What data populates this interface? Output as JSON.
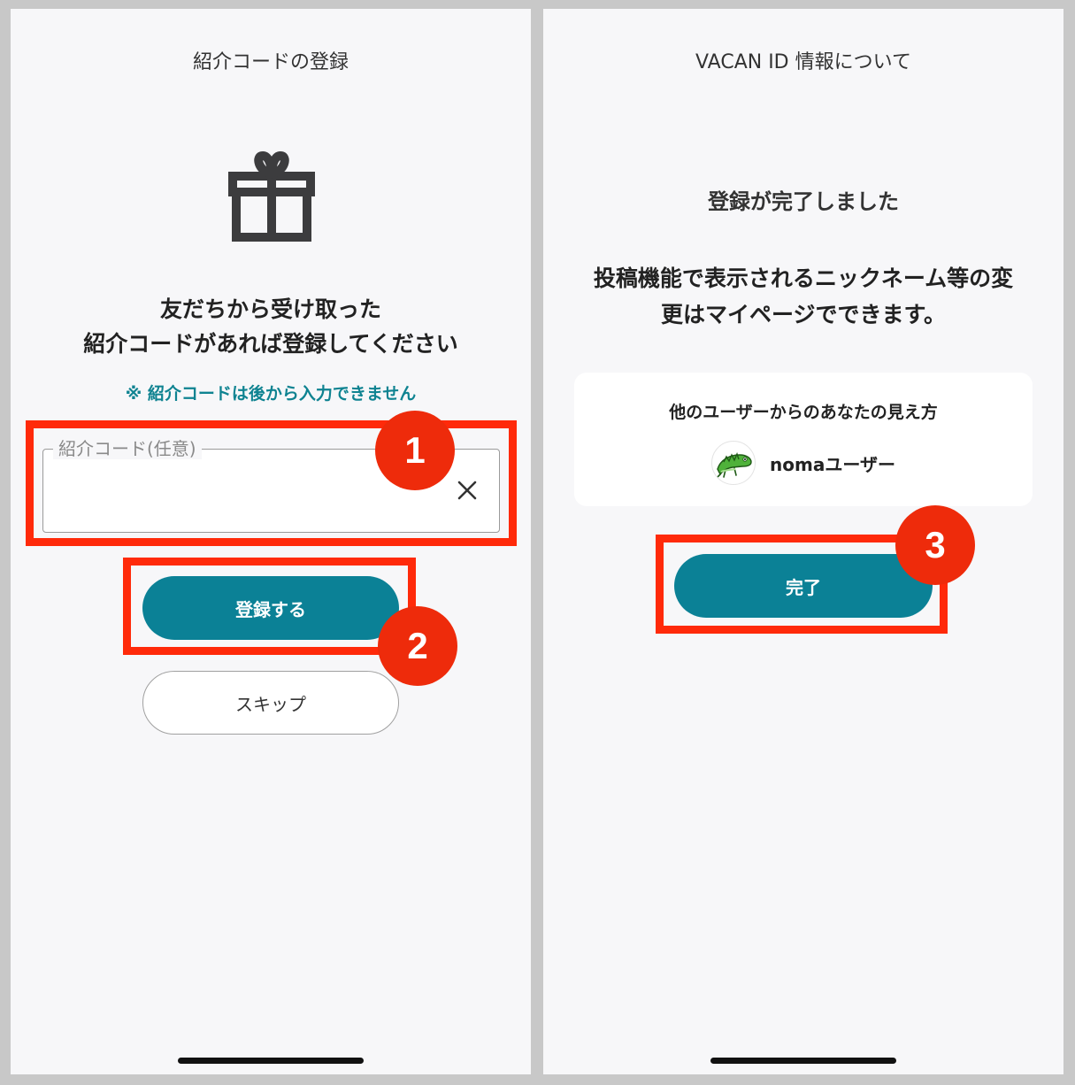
{
  "left_screen": {
    "title": "紹介コードの登録",
    "lead_line1": "友だちから受け取った",
    "lead_line2": "紹介コードがあれば登録してください",
    "note": "※ 紹介コードは後から入力できません",
    "code_field": {
      "label": "紹介コード(任意)",
      "value": ""
    },
    "register_button": "登録する",
    "skip_button": "スキップ"
  },
  "right_screen": {
    "title": "VACAN ID 情報について",
    "complete_title": "登録が完了しました",
    "body_line1": "投稿機能で表示されるニックネーム等の変",
    "body_line2": "更はマイページでできます。",
    "preview_caption": "他のユーザーからのあなたの見え方",
    "user_name": "nomaユーザー",
    "done_button": "完了"
  },
  "annotations": {
    "step1": "1",
    "step2": "2",
    "step3": "3"
  },
  "colors": {
    "primary": "#0b8196",
    "note": "#0f8391",
    "annotation": "#ff2a0a",
    "background": "#f7f7f9",
    "frame": "#c8c8c8"
  },
  "icons": {
    "gift": "gift-icon",
    "clear": "close-icon",
    "avatar": "iguana-avatar"
  }
}
